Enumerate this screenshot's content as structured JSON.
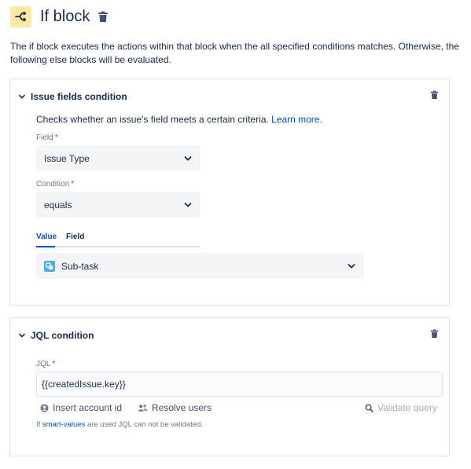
{
  "header": {
    "title": "If block",
    "icon": "branch-icon",
    "icon_bg": "#ffe8a1"
  },
  "description": "The if block executes the actions within that block when the all specified conditions matches. Otherwise, the following else blocks will be evaluated.",
  "issue_fields_condition": {
    "title": "Issue fields condition",
    "helptext": "Checks whether an issue's field meets a certain criteria.",
    "learn_more": "Learn more.",
    "field_label": "Field",
    "field_value": "Issue Type",
    "condition_label": "Condition",
    "condition_value": "equals",
    "tabs": [
      "Value",
      "Field"
    ],
    "active_tab": "Value",
    "value": "Sub-task"
  },
  "jql_condition": {
    "title": "JQL condition",
    "jql_label": "JQL",
    "jql_value": "{{createdIssue.key}}",
    "insert_account": "Insert account id",
    "resolve_users": "Resolve users",
    "validate_query": "Validate query",
    "footnote_prefix": "If",
    "footnote_link": "smart-values",
    "footnote_suffix": "are used JQL can not be validated."
  },
  "required_marker": "*",
  "colors": {
    "link": "#0052cc",
    "required": "#de350b",
    "border": "#dfe1e6",
    "field_bg": "#f4f5f7"
  }
}
